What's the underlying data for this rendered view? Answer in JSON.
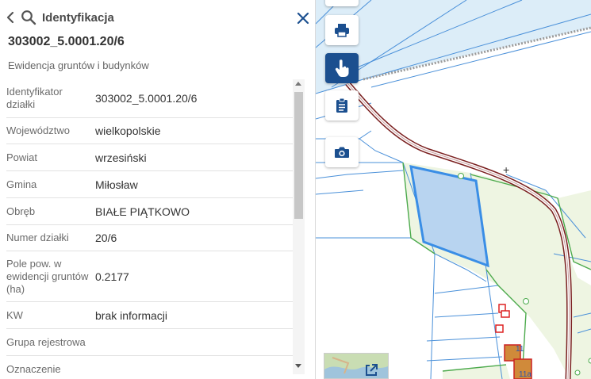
{
  "panel": {
    "title": "Identyfikacja",
    "parcel_id": "303002_5.0001.20/6",
    "registry": "Ewidencja gruntów i budynków",
    "rows": [
      {
        "label": "Identyfikator działki",
        "value": "303002_5.0001.20/6"
      },
      {
        "label": "Województwo",
        "value": "wielkopolskie"
      },
      {
        "label": "Powiat",
        "value": "wrzesiński"
      },
      {
        "label": "Gmina",
        "value": "Miłosław"
      },
      {
        "label": "Obręb",
        "value": "BIAŁE PIĄTKOWO"
      },
      {
        "label": "Numer działki",
        "value": "20/6"
      },
      {
        "label": "Pole pow. w ewidencji gruntów (ha)",
        "value": "0.2177"
      },
      {
        "label": "KW",
        "value": "brak informacji"
      },
      {
        "label": "Grupa rejestrowa",
        "value": ""
      },
      {
        "label": "Oznaczenie",
        "value": ""
      }
    ]
  },
  "map": {
    "labels": {
      "plus_mark": "+",
      "building_a": "11",
      "building_b": "11a"
    },
    "tools": [
      "print-icon",
      "identify-hand-icon",
      "clipboard-icon",
      "camera-icon"
    ],
    "colors": {
      "accent": "#1b4f8f",
      "parcel_line": "#3a8ee6",
      "road": "#7a1f1f",
      "selected_fill": "#b8d4f0",
      "water": "#d9ecf8",
      "meadow": "#eef5e4"
    }
  }
}
